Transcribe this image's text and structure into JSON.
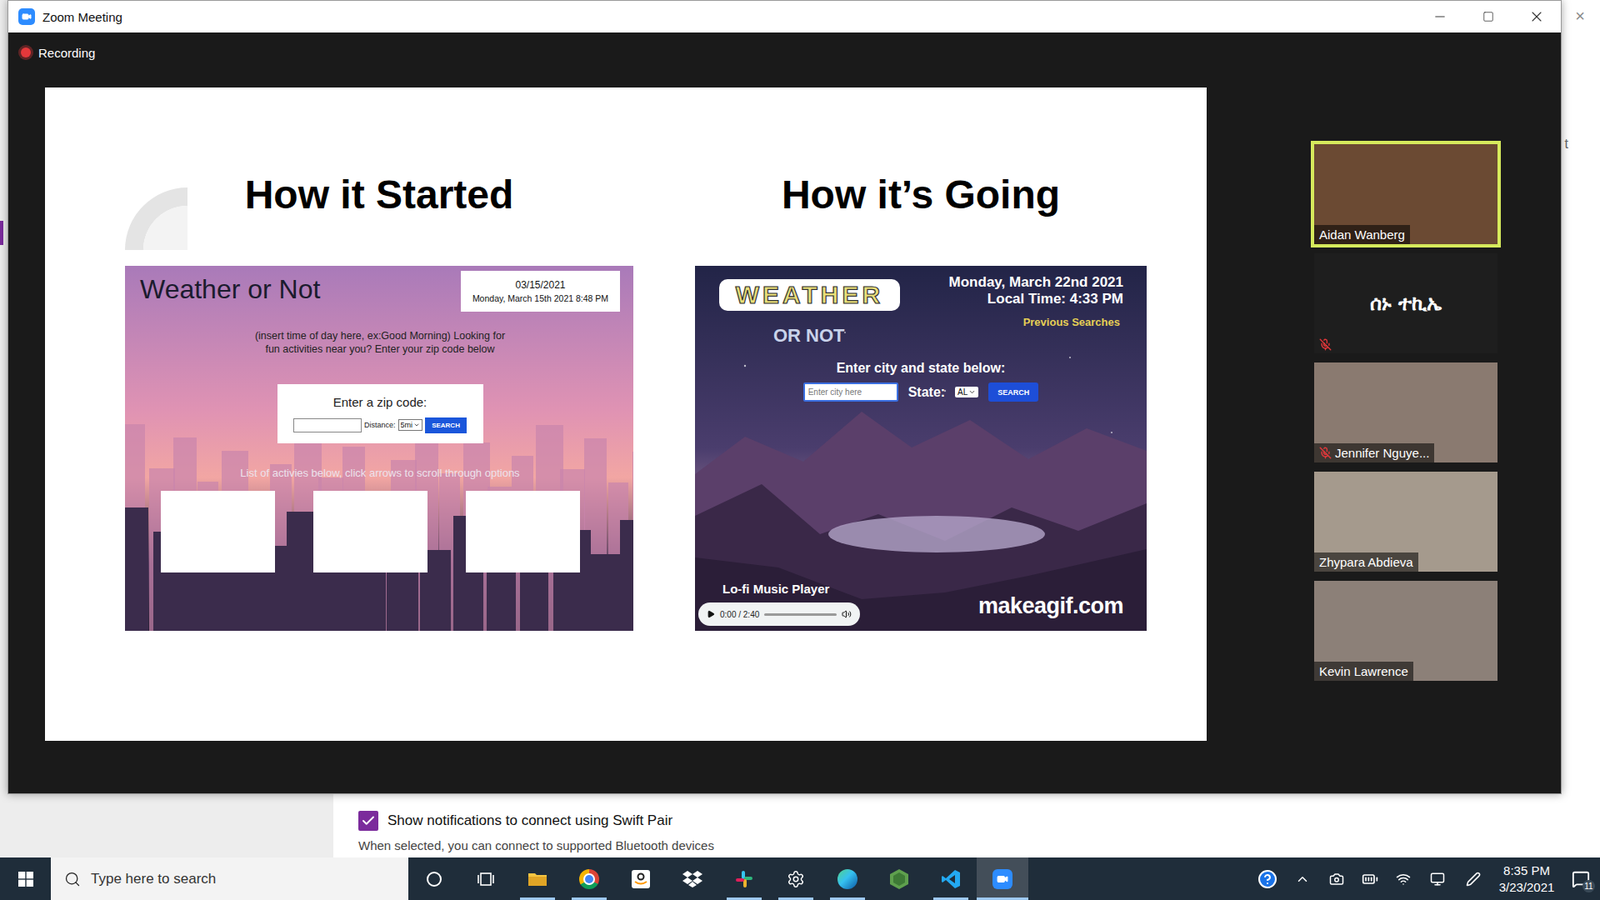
{
  "window": {
    "title": "Zoom Meeting",
    "recording": "Recording"
  },
  "slide": {
    "left": {
      "heading": "How it Started",
      "app": {
        "title": "Weather or Not",
        "date": "03/15/2021",
        "datetime": "Monday, March 15th 2021 8:48 PM",
        "greeting": "(insert time of day here, ex:Good Morning) Looking for fun activities near you? Enter your zip code below",
        "form_title": "Enter a zip code:",
        "distance_label": "Distance:",
        "distance_value": "5mi",
        "button": "SEARCH",
        "caption": "List of activies below, click arrows to scroll through options",
        "cards": [
          {
            "empty": true
          },
          {
            "empty": true
          },
          {
            "empty": true
          }
        ]
      }
    },
    "right": {
      "heading": "How it’s Going",
      "app": {
        "logo_top": "WEATHER",
        "logo_bottom": "OR NOT",
        "date": "Monday, March 22nd 2021",
        "local_time": "Local Time: 4:33 PM",
        "previous": "Previous Searches",
        "prompt": "Enter city and state below:",
        "city_placeholder": "Enter city here",
        "state_label": "State:",
        "state_value": "AL",
        "button": "SEARCH",
        "music_label": "Lo-fi Music Player",
        "player_time": "0:00 / 2:40",
        "player_level": 0,
        "watermark": "makeagif.com"
      }
    }
  },
  "participants": [
    {
      "name": "Aidan Wanberg",
      "speaking": true,
      "muted": false,
      "video": true
    },
    {
      "name": "ሰኑ ተኪኤ",
      "speaking": false,
      "muted": true,
      "video": false
    },
    {
      "name": "Jennifer Nguye...",
      "speaking": false,
      "muted": true,
      "video": true
    },
    {
      "name": "Zhypara Abdieva",
      "speaking": false,
      "muted": false,
      "video": true
    },
    {
      "name": "Kevin Lawrence",
      "speaking": false,
      "muted": false,
      "video": true
    }
  ],
  "background_window": {
    "close": "×",
    "fragment": "t",
    "checkbox_label": "Show notifications to connect using Swift Pair",
    "checked": true,
    "description": "When selected, you can connect to supported Bluetooth devices"
  },
  "taskbar": {
    "search_placeholder": "Type here to search",
    "apps": [
      {
        "kind": "cortana",
        "open": false,
        "selected": false
      },
      {
        "kind": "taskview",
        "open": false,
        "selected": false
      },
      {
        "kind": "explorer",
        "open": true,
        "selected": false
      },
      {
        "kind": "chrome",
        "open": true,
        "selected": false
      },
      {
        "kind": "amazon",
        "open": false,
        "selected": false
      },
      {
        "kind": "dropbox",
        "open": false,
        "selected": false
      },
      {
        "kind": "slack",
        "open": true,
        "selected": false
      },
      {
        "kind": "settings",
        "open": true,
        "selected": false
      },
      {
        "kind": "edge",
        "open": true,
        "selected": false
      },
      {
        "kind": "node",
        "open": false,
        "selected": false
      },
      {
        "kind": "vscode",
        "open": true,
        "selected": false
      },
      {
        "kind": "zoom",
        "open": true,
        "selected": true
      }
    ],
    "time": "8:35 PM",
    "date": "3/23/2021",
    "notifications": "11"
  }
}
